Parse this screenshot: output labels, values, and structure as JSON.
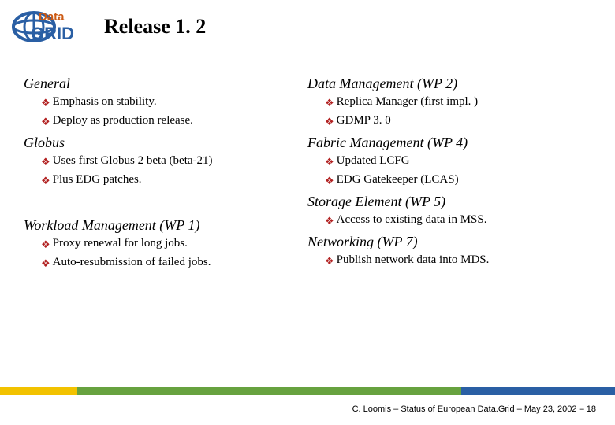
{
  "logo": {
    "top_word": "Data",
    "bottom_word": "GRID"
  },
  "title": "Release 1. 2",
  "left": {
    "sections": [
      {
        "heading": "General",
        "items": [
          "Emphasis on stability.",
          "Deploy as production release."
        ]
      },
      {
        "heading": "Globus",
        "items": [
          "Uses first Globus 2 beta (beta-21)",
          "Plus EDG patches."
        ]
      },
      {
        "heading": "",
        "items": []
      },
      {
        "heading": "Workload Management (WP 1)",
        "items": [
          "Proxy renewal for long jobs.",
          "Auto-resubmission of failed jobs."
        ]
      }
    ]
  },
  "right": {
    "sections": [
      {
        "heading": "Data Management (WP 2)",
        "items": [
          "Replica Manager (first impl. )",
          "GDMP 3. 0"
        ]
      },
      {
        "heading": "Fabric Management (WP 4)",
        "items": [
          "Updated LCFG",
          "EDG Gatekeeper (LCAS)"
        ]
      },
      {
        "heading": "Storage Element (WP 5)",
        "items": [
          "Access to existing data in MSS."
        ]
      },
      {
        "heading": "Networking (WP 7)",
        "items": [
          "Publish network data into MDS."
        ]
      }
    ]
  },
  "footer": "C. Loomis – Status of European Data.Grid – May 23, 2002 – 18"
}
